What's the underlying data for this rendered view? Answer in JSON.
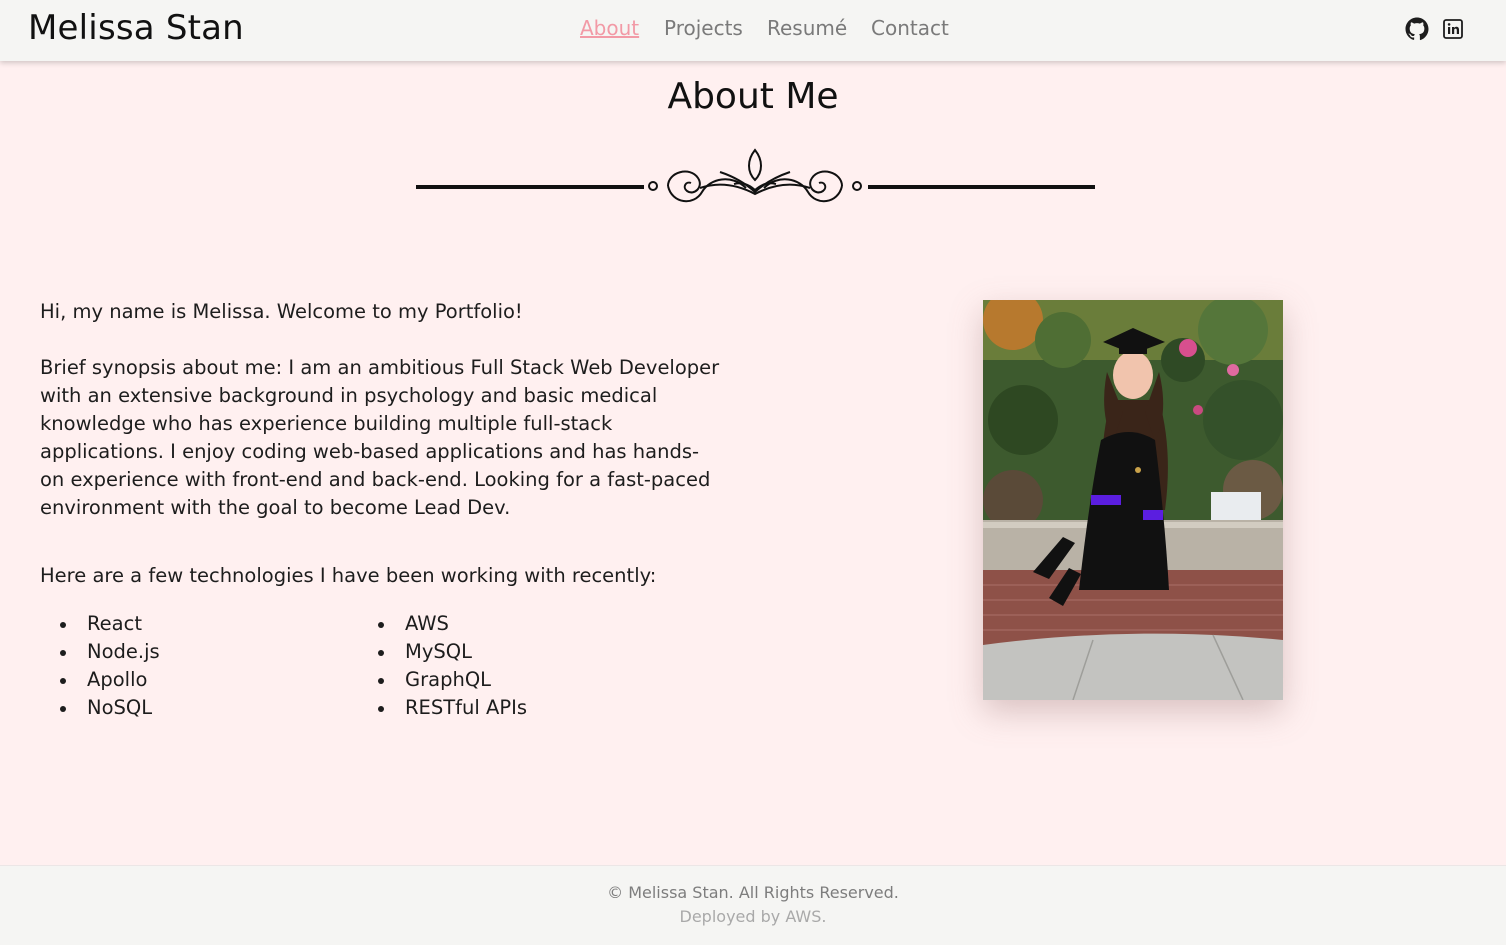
{
  "header": {
    "brand": "Melissa Stan",
    "nav": [
      {
        "label": "About",
        "active": true
      },
      {
        "label": "Projects",
        "active": false
      },
      {
        "label": "Resumé",
        "active": false
      },
      {
        "label": "Contact",
        "active": false
      }
    ],
    "social_icons": [
      "github-icon",
      "linkedin-icon"
    ]
  },
  "about": {
    "title": "About Me",
    "greeting": "Hi, my name is Melissa. Welcome to my Portfolio!",
    "synopsis": "Brief synopsis about me: I am an ambitious Full Stack Web Developer with an extensive background in psychology and basic medical knowledge who has experience building multiple full-stack applications. I enjoy coding web-based applications and has hands-on experience with front-end and back-end. Looking for a fast-paced environment with the goal to become Lead Dev.",
    "tech_intro": "Here are a few technologies I have been working with recently:",
    "tech_col1": [
      "React",
      "Node.js",
      "Apollo",
      "NoSQL"
    ],
    "tech_col2": [
      "AWS",
      "MySQL",
      "GraphQL",
      "RESTful APIs"
    ]
  },
  "footer": {
    "copyright": "© Melissa Stan. All Rights Reserved.",
    "deployed": "Deployed by AWS."
  },
  "colors": {
    "page_bg": "#fff0f0",
    "nav_bg": "#f5f5f3",
    "active_link": "#f29aa6",
    "nav_link": "#7a7a7a"
  }
}
